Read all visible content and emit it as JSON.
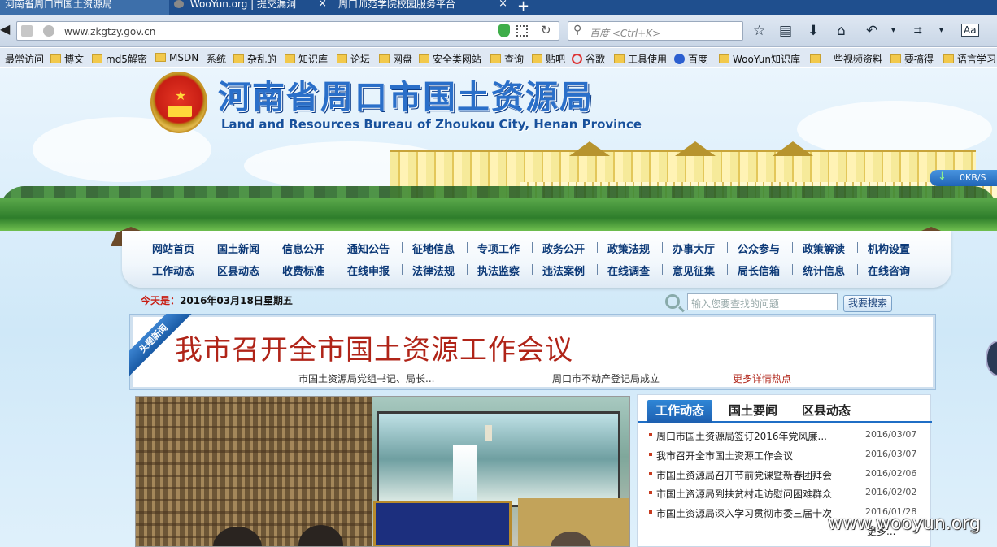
{
  "browser": {
    "tabs": [
      {
        "label": "河南省周口市国土资源局",
        "active": true
      },
      {
        "label": "WooYun.org | 提交漏洞",
        "active": false
      },
      {
        "label": "周口师范学院校园服务平台",
        "active": false
      }
    ],
    "new_tab_glyph": "+",
    "url": "www.zkgtzy.gov.cn",
    "search_placeholder": "百度 <Ctrl+K>",
    "speed_indicator": "0KB/S"
  },
  "bookmarks": [
    {
      "label": "最常访问",
      "icon": "none"
    },
    {
      "label": "博文",
      "icon": "folder-icon"
    },
    {
      "label": "md5解密",
      "icon": "folder-icon"
    },
    {
      "label": "MSDN",
      "icon": "folder-icon"
    },
    {
      "label": "系统",
      "icon": "none"
    },
    {
      "label": "杂乱的",
      "icon": "folder-icon"
    },
    {
      "label": "知识库",
      "icon": "folder-icon"
    },
    {
      "label": "论坛",
      "icon": "folder-icon"
    },
    {
      "label": "网盘",
      "icon": "folder-icon"
    },
    {
      "label": "安全类网站",
      "icon": "folder-icon"
    },
    {
      "label": "查询",
      "icon": "folder-icon"
    },
    {
      "label": "贴吧",
      "icon": "folder-icon"
    },
    {
      "label": "谷歌",
      "icon": "google-icon"
    },
    {
      "label": "工具使用",
      "icon": "folder-icon"
    },
    {
      "label": "百度",
      "icon": "baidu-icon"
    },
    {
      "label": "WooYun知识库",
      "icon": "folder-icon"
    },
    {
      "label": "一些视频资料",
      "icon": "folder-icon"
    },
    {
      "label": "要搞得",
      "icon": "folder-icon"
    },
    {
      "label": "语言学习",
      "icon": "folder-icon"
    }
  ],
  "site": {
    "title": "河南省周口市国土资源局",
    "subtitle": "Land and Resources Bureau of Zhoukou City, Henan Province",
    "menu_row1": [
      "网站首页",
      "国土新闻",
      "信息公开",
      "通知公告",
      "征地信息",
      "专项工作",
      "政务公开",
      "政策法规",
      "办事大厅",
      "公众参与",
      "政策解读",
      "机构设置"
    ],
    "menu_row2": [
      "工作动态",
      "区县动态",
      "收费标准",
      "在线申报",
      "法律法规",
      "执法监察",
      "违法案例",
      "在线调查",
      "意见征集",
      "局长信箱",
      "统计信息",
      "在线咨询"
    ],
    "today_label": "今天是：",
    "today_value": "2016年03月18日星期五",
    "search_placeholder": "输入您要查找的问题",
    "search_button": "我要搜索",
    "headline_ribbon": "头题新闻",
    "headline": "我市召开全市国土资源工作会议",
    "headline_links": [
      "市国土资源局党组书记、局长...",
      "周口市不动产登记局成立"
    ],
    "headline_more": "更多详情热点",
    "news_tabs": [
      "工作动态",
      "国土要闻",
      "区县动态"
    ],
    "news": [
      {
        "title": "周口市国土资源局签订2016年党风廉...",
        "date": "2016/03/07"
      },
      {
        "title": "我市召开全市国土资源工作会议",
        "date": "2016/03/07"
      },
      {
        "title": "市国土资源局召开节前党课暨新春团拜会",
        "date": "2016/02/06"
      },
      {
        "title": "市国土资源局到扶贫村走访慰问困难群众",
        "date": "2016/02/02"
      },
      {
        "title": "市国土资源局深入学习贯彻市委三届十次",
        "date": "2016/01/28"
      }
    ],
    "news_more": "更多...",
    "watermark": "www.wooyun.org"
  },
  "colors": {
    "tabbar": "#1f4f8e",
    "menu_text": "#0d3a78",
    "headline": "#b02418",
    "tab_active": "#1f6ec5"
  }
}
